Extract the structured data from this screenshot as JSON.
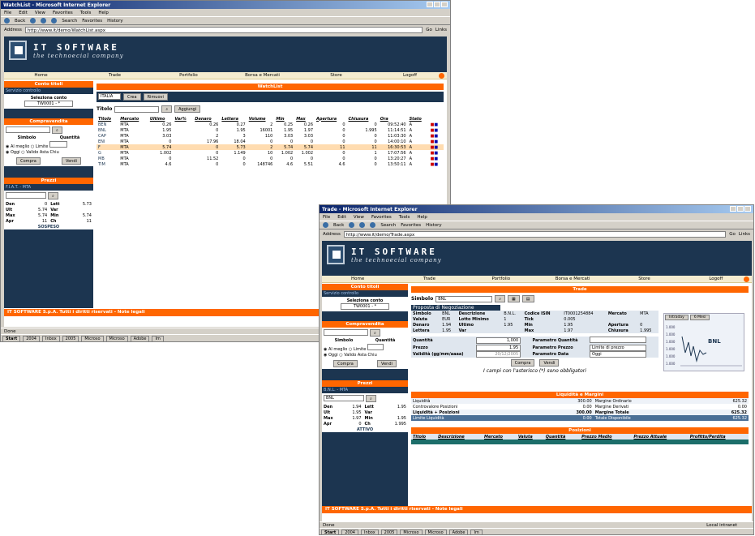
{
  "brand": {
    "name": "IT SOFTWARE",
    "tagline": "the technoecial company"
  },
  "nav": [
    "Home",
    "Trade",
    "Portfolio",
    "Borsa e Mercati",
    "Store",
    "Logoff"
  ],
  "footer": "IT SOFTWARE S.p.A.   Tutti i diritti riservati - Note legali",
  "w1": {
    "title": "WatchList - Microsoft Internet Explorer",
    "menu": [
      "File",
      "Edit",
      "View",
      "Favorites",
      "Tools",
      "Help"
    ],
    "toolbar": [
      "Back",
      "Search",
      "Favorites",
      "History"
    ],
    "address_label": "Address",
    "address": "http://www.it/demo/WatchList.aspx",
    "go": "Go",
    "links": "Links",
    "side": {
      "conto_head": "Conto titoli",
      "conto_sub": "Servizio controllo",
      "conto_label": "Seleziona conto",
      "conto_value": "TW0001 - *",
      "comp_head": "Compravendita",
      "simbolo": "Simbolo",
      "quantita": "Quantità",
      "r1": "Al meglio",
      "r2": "Limite",
      "r3": "Oggi",
      "r4": "Valido Asta Chiu",
      "compra": "Compra",
      "vendi": "Vendi",
      "prezzi_head": "Prezzi",
      "prezzi_sub": "F.I.A.T. - MTA",
      "prezzi": [
        [
          "Den",
          "0",
          "Lett",
          "5.73"
        ],
        [
          "Ult",
          "5.74",
          "Var",
          ""
        ],
        [
          "Max",
          "5.74",
          "Min",
          "5.74"
        ],
        [
          "Apr",
          "11",
          "Ch",
          "11"
        ]
      ],
      "sospeso": "SOSPESO"
    },
    "main": {
      "title": "WatchList",
      "list_value": "ITALIA",
      "btn_crea": "Crea",
      "btn_rimuovi": "Rimuovi",
      "titolo_label": "Titolo",
      "aggiungi": "Aggiungi",
      "cols": [
        "Titolo",
        "Mercato",
        "Ultimo",
        "Var%",
        "Denaro",
        "Lettera",
        "Volume",
        "Min",
        "Max",
        "Apertura",
        "Chiusura",
        "Ora",
        "Stato"
      ],
      "rows": [
        [
          "BEN",
          "MTA",
          "0.26",
          "",
          "0.26",
          "0.27",
          "2",
          "0.25",
          "0.26",
          "0",
          "0",
          "09:52:40",
          "A"
        ],
        [
          "BNL",
          "MTA",
          "1.95",
          "",
          "0",
          "1.95",
          "16001",
          "1.95",
          "1.97",
          "0",
          "1.995",
          "11:14:51",
          "A"
        ],
        [
          "CAP",
          "MTA",
          "3.03",
          "",
          "2",
          "3",
          "110",
          "3.03",
          "3.03",
          "0",
          "0",
          "11:03:30",
          "A"
        ],
        [
          "ENI",
          "MTA",
          "0",
          "",
          "17.96",
          "18.04",
          "0",
          "0",
          "0",
          "0",
          "0",
          "14:00:10",
          "A"
        ],
        [
          "F",
          "MTA",
          "5.74",
          "",
          "0",
          "5.73",
          "2",
          "5.74",
          "5.74",
          "11",
          "11",
          "16:30:53",
          "A"
        ],
        [
          "G",
          "MTA",
          "1.002",
          "",
          "0",
          "1.149",
          "10",
          "1.002",
          "1.002",
          "0",
          "1",
          "17:07:56",
          "A"
        ],
        [
          "MB",
          "MTA",
          "0",
          "",
          "11.52",
          "0",
          "0",
          "0",
          "0",
          "0",
          "0",
          "13:20:27",
          "A"
        ],
        [
          "TIM",
          "MTA",
          "4.6",
          "",
          "0",
          "0",
          "148746",
          "4.6",
          "5.51",
          "4.6",
          "0",
          "13:50:11",
          "A"
        ]
      ]
    },
    "status": "Done",
    "tasks": [
      "Start",
      "2004",
      "Inbox",
      "2005",
      "Microso",
      "Microso",
      "Adobe",
      "Im"
    ]
  },
  "w2": {
    "title": "Trade - Microsoft Internet Explorer",
    "menu": [
      "File",
      "Edit",
      "View",
      "Favorites",
      "Tools",
      "Help"
    ],
    "toolbar": [
      "Back",
      "Search",
      "Favorites",
      "History"
    ],
    "address_label": "Address",
    "address": "http://www.it/demo/Trade.aspx",
    "go": "Go",
    "links": "Links",
    "side": {
      "conto_head": "Conto titoli",
      "conto_sub": "Servizio controllo",
      "conto_label": "Seleziona conto",
      "conto_value": "TW0001 - *",
      "comp_head": "Compravendita",
      "simbolo": "Simbolo",
      "quantita": "Quantità",
      "r1": "Al meglio",
      "r2": "Limite",
      "r3": "Oggi",
      "r4": "Valido Asta Chiu",
      "compra": "Compra",
      "vendi": "Vendi",
      "prezzi_head": "Prezzi",
      "prezzi_sub": "B.N.L. - MTA",
      "prezzi_input": "BNL",
      "prezzi": [
        [
          "Den",
          "1.94",
          "Lett",
          "1.95"
        ],
        [
          "Ult",
          "1.95",
          "Var",
          ""
        ],
        [
          "Max",
          "1.97",
          "Min",
          "1.95"
        ],
        [
          "Apr",
          "0",
          "Ch",
          "1.995"
        ]
      ],
      "attivo": "ATTIVO"
    },
    "trade": {
      "title": "Trade",
      "simbolo_label": "Simbolo",
      "simbolo_value": "BNL",
      "info_head": "Proposta di Negoziazione",
      "info": [
        [
          "Simbolo",
          "BNL",
          "Descrizione",
          "B.N.L.",
          "Codice ISIN",
          "IT0001254884",
          "Mercato",
          "MTA"
        ],
        [
          "Valuta",
          "EUR",
          "Lotto Minimo",
          "1",
          "Tick",
          "0.005",
          "",
          ""
        ],
        [
          "Denaro",
          "1.94",
          "Ultimo",
          "1.95",
          "Min",
          "1.95",
          "Apertura",
          "0"
        ],
        [
          "Lettera",
          "1.95",
          "Var",
          "",
          "Max",
          "1.97",
          "Chiusura",
          "1.995"
        ]
      ],
      "quantita_label": "Quantità",
      "quantita_value": "1,000",
      "prezzo_label": "Prezzo",
      "prezzo_value": "1.95",
      "validita_label": "Validità (gg/mm/aaaa)",
      "validita_value": "20/12/2005",
      "pq_label": "Parametro Quantità",
      "pq_value": "",
      "pp_label": "Parametro Prezzo",
      "pp_value": "Limite di prezzo",
      "pd_label": "Parametro Data",
      "pd_value": "Oggi",
      "compra": "Compra",
      "vendi": "Vendi",
      "note": "I campi con l'asterisco (*) sono obbligatori",
      "chart_tabs": [
        "Intraday",
        "6 Mesi"
      ],
      "chart_label": "BNL",
      "chart_yticks": [
        "1.000",
        "1.000",
        "1.000",
        "1.000",
        "1.000",
        "1.000"
      ]
    },
    "liquidita": {
      "head": "Liquidità e Margini",
      "rows": [
        [
          "Liquidità",
          "300.00",
          "Margine Ordinario",
          "625.32"
        ],
        [
          "Controvalore Posizioni",
          "0.00",
          "Margine Derivati",
          "0.00"
        ],
        [
          "Liquidità + Posizioni",
          "300.00",
          "Margine Totale",
          "625.32"
        ],
        [
          "Limite Liquidità",
          "0.00",
          "Totale Disponibile",
          "625.32"
        ]
      ]
    },
    "posizioni": {
      "head": "Posizioni",
      "cols": [
        "Titolo",
        "Descrizione",
        "Mercato",
        "Valuta",
        "Quantità",
        "Prezzo Medio",
        "Prezzo Attuale",
        "Profitto/Perdita"
      ]
    },
    "status": "Done",
    "zone": "Local intranet",
    "tasks": [
      "Start",
      "2004",
      "Inbox",
      "2005",
      "Microso",
      "Microso",
      "Adobe",
      "Im"
    ]
  }
}
